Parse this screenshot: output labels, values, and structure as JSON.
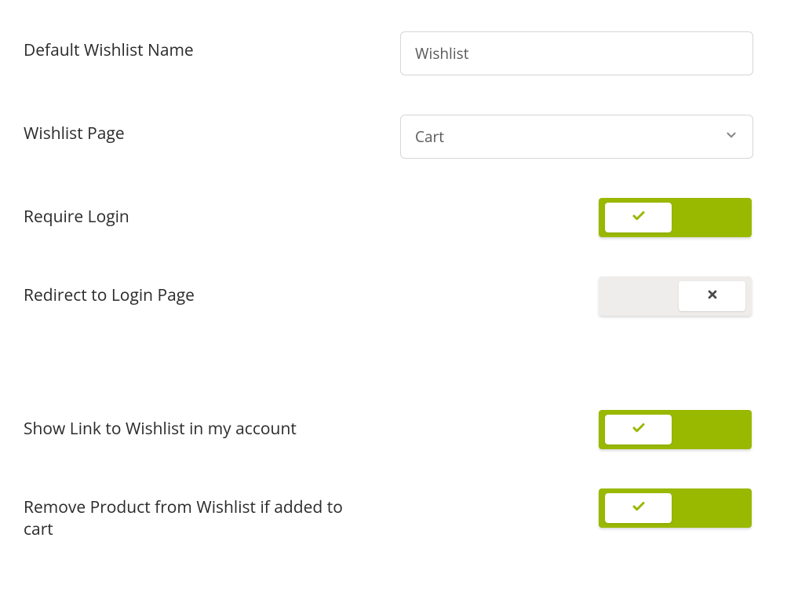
{
  "settings": {
    "default_wishlist_name": {
      "label": "Default Wishlist Name",
      "value": "Wishlist"
    },
    "wishlist_page": {
      "label": "Wishlist Page",
      "selected": "Cart"
    },
    "require_login": {
      "label": "Require Login",
      "value": true
    },
    "redirect_login": {
      "label": "Redirect to Login Page",
      "value": false
    },
    "show_link_account": {
      "label": "Show Link to Wishlist in my account",
      "value": true
    },
    "remove_if_added": {
      "label": "Remove Product from Wishlist if added to cart",
      "value": true
    }
  }
}
